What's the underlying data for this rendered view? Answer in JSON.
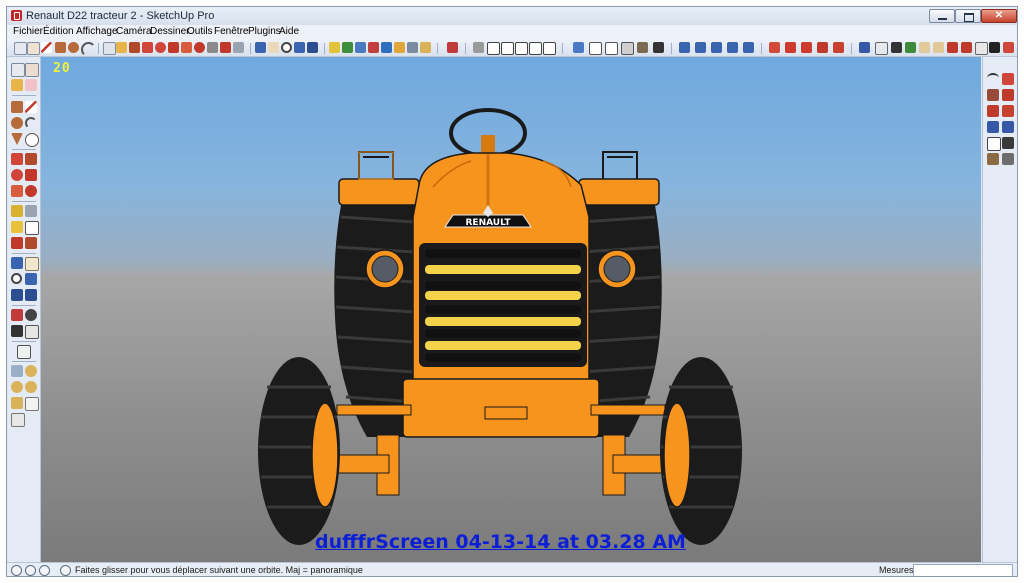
{
  "window": {
    "title": "Renault D22 tracteur 2 - SketchUp Pro"
  },
  "menu": {
    "items": [
      "Fichier",
      "Édition",
      "Affichage",
      "Caméra",
      "Dessiner",
      "Outils",
      "Fenêtre",
      "Plugins",
      "Aide"
    ]
  },
  "viewport": {
    "counter": "20",
    "caption": "dufffrScreen 04-13-14 at 03.28 AM",
    "model": {
      "brand_badge": "RENAULT",
      "body_color": "#f7941d",
      "tire_color": "#1b1b1b",
      "grille_bar_color": "#f4d34a"
    }
  },
  "statusbar": {
    "hint": "Faites glisser pour vous déplacer suivant une orbite.  Maj = panoramique",
    "measures_label": "Mesures",
    "measures_value": ""
  }
}
